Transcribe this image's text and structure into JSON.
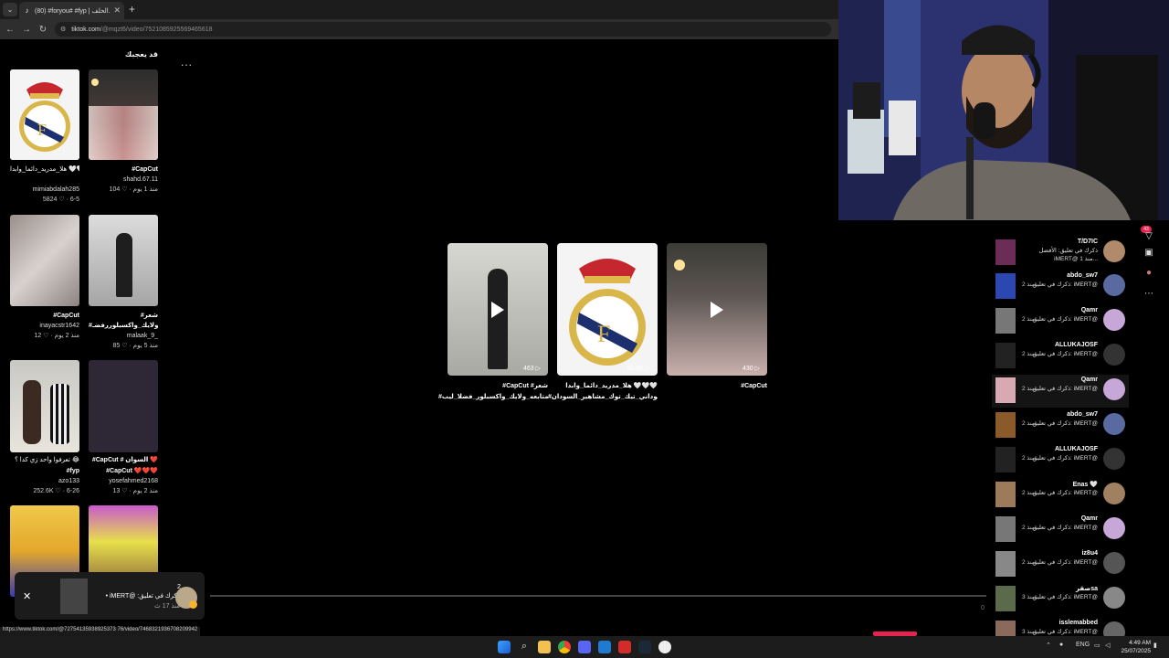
{
  "browser": {
    "tab_title": "(80) #foryou# #fyp | الحلف...",
    "new_tab_label": "+",
    "url_domain": "tiktok.com",
    "url_path": "/@mqzt6/video/7521085925569465618",
    "status_url": "https://www.tiktok.com/@72754135938925373 76/video/7468321936708209942"
  },
  "sidebar": {
    "title": "قد يعجبك",
    "more": "...",
    "items": [
      {
        "caption": "هلا_مدريد_دائما_وابدا 🤍🤍 ...",
        "caption2": "",
        "user": "mimiabdalah285",
        "stats": "5824 ♡ · 6-5",
        "bold": false
      },
      {
        "caption": "#CapCut",
        "caption2": "",
        "user": "shahd.67.11",
        "stats": "104 ♡ · منذ 1 يوم",
        "bold": true
      },
      {
        "caption": "#CapCut",
        "caption2": "",
        "user": "inayacstr1642",
        "stats": "12 ♡ · منذ 2 يوم",
        "bold": true
      },
      {
        "caption": "#شعر",
        "caption2": "#متابعه_ولايك_واكسبلوررفضـ",
        "user": "malaak_9_",
        "stats": "85 ♡ · منذ 5 يوم",
        "bold": true
      },
      {
        "caption": "تعرفوا واحد زي كدا ؟ 😂",
        "caption2": "#fyp",
        "user": "azo133",
        "stats": "252.6K ♡ · 6-26",
        "bold": false
      },
      {
        "caption": "#CapCut # السوان ❤️",
        "caption2": "#CapCut ❤️❤️❤️",
        "user": "yosefahmed2168",
        "stats": "13 ♡ · منذ 2 يوم",
        "bold": true
      }
    ]
  },
  "videos": [
    {
      "count": "463",
      "caption": "#CapCut #شعر",
      "caption2": "#متابعه_ولايك_واكسبلور_فضلا_ليب..."
    },
    {
      "count": "80.9K",
      "caption": "هلا_مدريد_دائما_وابدا 🤍🤍🤍",
      "caption2": "#سوداني_تيك_توك_مشاهير_السودان..."
    },
    {
      "count": "430",
      "caption": "#CapCut",
      "caption2": ""
    }
  ],
  "popup": {
    "close": "✕",
    "text": "• iMERT@ :ذكرك في تعليق",
    "time": "منذ 17 ث",
    "badge": "2"
  },
  "progress_zero": "0",
  "notifications": [
    {
      "name": "T/D7IC",
      "text": "ذكرك في تعليق: الأفضل",
      "text2": "iMERT@ منذ 1...",
      "count": "",
      "thumb": "#6b2d55",
      "av": "#b08a6a"
    },
    {
      "name": "abdo_sw7",
      "text": "ذكرك في تعليق: iMERT@",
      "count": "2 منذ",
      "thumb": "#2b48b0",
      "av": "#5a6aa0"
    },
    {
      "name": "Qamr",
      "text": "ذكرك في تعليق: iMERT@",
      "count": "2 منذ",
      "thumb": "#777",
      "av": "#c7a6d8"
    },
    {
      "name": "ALLUKAJOSF",
      "text": "ذكرك في تعليق: iMERT@",
      "count": "2 منذ",
      "thumb": "#222",
      "av": "#333"
    },
    {
      "name": "Qamr",
      "text": "ذكرك في تعليق: iMERT@",
      "count": "2 منذ",
      "thumb": "#d9a9b3",
      "av": "#c7a6d8"
    },
    {
      "name": "abdo_sw7",
      "text": "ذكرك في تعليق: iMERT@",
      "count": "2 منذ",
      "thumb": "#8b5a2b",
      "av": "#5a6aa0"
    },
    {
      "name": "ALLUKAJOSF",
      "text": "ذكرك في تعليق: iMERT@",
      "count": "2 منذ",
      "thumb": "#222",
      "av": "#333"
    },
    {
      "name": "Enas 🤍",
      "text": "ذكرك في تعليق: iMERT@",
      "count": "2 منذ",
      "thumb": "#9c7a5a",
      "av": "#a08060"
    },
    {
      "name": "Qamr",
      "text": "ذكرك في تعليق: iMERT@",
      "count": "2 منذ",
      "thumb": "#777",
      "av": "#c7a6d8"
    },
    {
      "name": "iz8u4",
      "text": "ذكرك في تعليق: iMERT@",
      "count": "2 منذ",
      "thumb": "#888",
      "av": "#555"
    },
    {
      "name": "صقرsa",
      "text": "ذكرك في تعليق: iMERT@",
      "count": "3 منذ",
      "thumb": "#5a6a4a",
      "av": "#888"
    },
    {
      "name": "isslemabbed",
      "text": "ذكرك في تعليق: iMERT@",
      "count": "3 منذ",
      "thumb": "#8a6a5a",
      "av": "#666"
    }
  ],
  "side_badge": "43",
  "taskbar": {
    "lang": "ENG",
    "time": "4:49 AM",
    "date": "25/07/2025"
  }
}
